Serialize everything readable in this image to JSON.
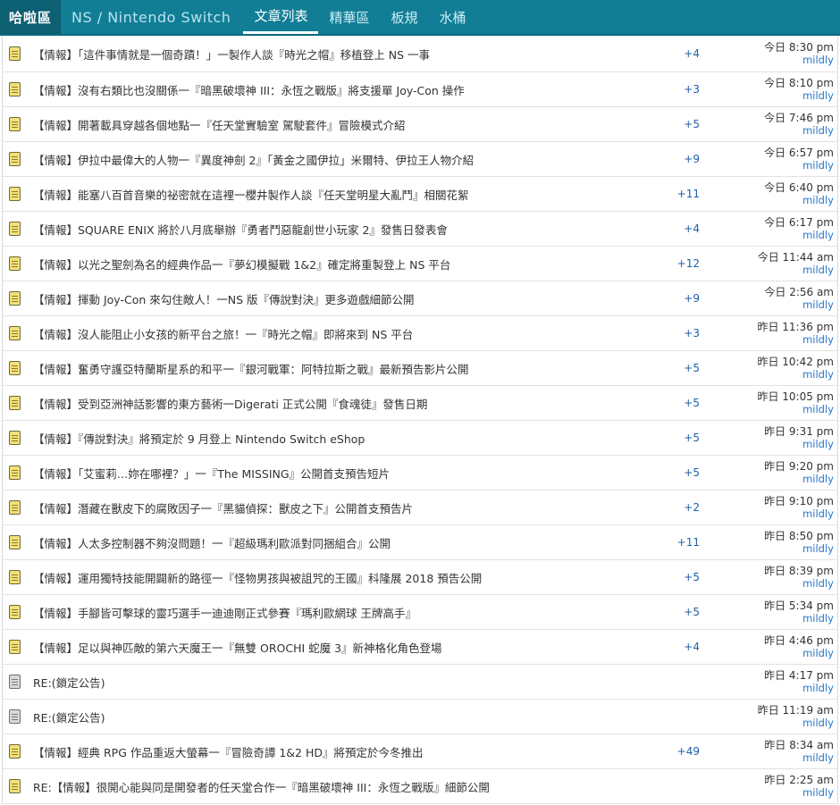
{
  "nav": {
    "brand": "哈啦區",
    "board": "NS / Nintendo Switch",
    "tabs": [
      {
        "label": "文章列表",
        "active": true
      },
      {
        "label": "精華區",
        "active": false
      },
      {
        "label": "板規",
        "active": false
      },
      {
        "label": "水桶",
        "active": false
      }
    ]
  },
  "topics": [
    {
      "icon": "doc-yellow-icon",
      "title": "【情報】「這件事情就是一個奇蹟！」一製作人談『時光之帽』移植登上 NS 一事",
      "count": "+4",
      "time": "今日 8:30 pm",
      "user": "mildly"
    },
    {
      "icon": "doc-yellow-icon",
      "title": "【情報】沒有右類比也沒關係一『暗黑破壞神 III：永恆之戰版』將支援單 Joy-Con 操作",
      "count": "+3",
      "time": "今日 8:10 pm",
      "user": "mildly"
    },
    {
      "icon": "doc-yellow-icon",
      "title": "【情報】開著載具穿越各個地點一『任天堂實驗室 駕駛套件』冒險模式介紹",
      "count": "+5",
      "time": "今日 7:46 pm",
      "user": "mildly"
    },
    {
      "icon": "doc-yellow-icon",
      "title": "【情報】伊拉中最偉大的人物一『異度神劍 2』「黃金之國伊拉」米爾特、伊拉王人物介紹",
      "count": "+9",
      "time": "今日 6:57 pm",
      "user": "mildly"
    },
    {
      "icon": "doc-yellow-icon",
      "title": "【情報】能塞八百首音樂的祕密就在這裡一櫻井製作人談『任天堂明星大亂鬥』相關花絮",
      "count": "+11",
      "time": "今日 6:40 pm",
      "user": "mildly"
    },
    {
      "icon": "doc-yellow-icon",
      "title": "【情報】SQUARE ENIX 將於八月底舉辦『勇者鬥惡龍創世小玩家 2』發售日發表會",
      "count": "+4",
      "time": "今日 6:17 pm",
      "user": "mildly"
    },
    {
      "icon": "doc-yellow-icon",
      "title": "【情報】以光之聖劍為名的經典作品一『夢幻模擬戰 1&2』確定將重製登上 NS 平台",
      "count": "+12",
      "time": "今日 11:44 am",
      "user": "mildly"
    },
    {
      "icon": "doc-yellow-icon",
      "title": "【情報】揮動 Joy-Con 來勾住敵人！一NS 版『傳說對決』更多遊戲細節公開",
      "count": "+9",
      "time": "今日 2:56 am",
      "user": "mildly"
    },
    {
      "icon": "doc-yellow-icon",
      "title": "【情報】沒人能阻止小女孩的新平台之旅！一『時光之帽』即將來到 NS 平台",
      "count": "+3",
      "time": "昨日 11:36 pm",
      "user": "mildly"
    },
    {
      "icon": "doc-yellow-icon",
      "title": "【情報】奮勇守護亞特蘭斯星系的和平一『銀河戰軍：阿特拉斯之戰』最新預告影片公開",
      "count": "+5",
      "time": "昨日 10:42 pm",
      "user": "mildly"
    },
    {
      "icon": "doc-yellow-icon",
      "title": "【情報】受到亞洲神話影響的東方藝術一Digerati 正式公開『食魂徒』發售日期",
      "count": "+5",
      "time": "昨日 10:05 pm",
      "user": "mildly"
    },
    {
      "icon": "doc-yellow-icon",
      "title": "【情報】『傳說對決』將預定於 9 月登上 Nintendo Switch eShop",
      "count": "+5",
      "time": "昨日 9:31 pm",
      "user": "mildly"
    },
    {
      "icon": "doc-yellow-icon",
      "title": "【情報】「艾蜜莉…妳在哪裡？」一『The MISSING』公開首支預告短片",
      "count": "+5",
      "time": "昨日 9:20 pm",
      "user": "mildly"
    },
    {
      "icon": "doc-yellow-icon",
      "title": "【情報】潛藏在獸皮下的腐敗因子一『黑貓偵探：獸皮之下』公開首支預告片",
      "count": "+2",
      "time": "昨日 9:10 pm",
      "user": "mildly"
    },
    {
      "icon": "doc-yellow-icon",
      "title": "【情報】人太多控制器不夠沒問題！一『超級瑪利歐派對同捆組合』公開",
      "count": "+11",
      "time": "昨日 8:50 pm",
      "user": "mildly"
    },
    {
      "icon": "doc-yellow-icon",
      "title": "【情報】運用獨特技能開闢新的路徑一『怪物男孩與被詛咒的王國』科隆展 2018 預告公開",
      "count": "+5",
      "time": "昨日 8:39 pm",
      "user": "mildly"
    },
    {
      "icon": "doc-yellow-icon",
      "title": "【情報】手腳皆可擊球的靈巧選手一迪迪剛正式參賽『瑪利歐網球 王牌高手』",
      "count": "+5",
      "time": "昨日 5:34 pm",
      "user": "mildly"
    },
    {
      "icon": "doc-yellow-icon",
      "title": "【情報】足以與神匹敵的第六天魔王一『無雙 OROCHI 蛇魔 3』新神格化角色登場",
      "count": "+4",
      "time": "昨日 4:46 pm",
      "user": "mildly"
    },
    {
      "icon": "doc-gray-icon",
      "title": "RE:(鎖定公告)",
      "count": "",
      "time": "昨日 4:17 pm",
      "user": "mildly"
    },
    {
      "icon": "doc-gray-icon",
      "title": "RE:(鎖定公告)",
      "count": "",
      "time": "昨日 11:19 am",
      "user": "mildly"
    },
    {
      "icon": "doc-yellow-icon",
      "title": "【情報】經典 RPG 作品重返大螢幕一『冒險奇譚 1&2 HD』將預定於今冬推出",
      "count": "+49",
      "time": "昨日 8:34 am",
      "user": "mildly"
    },
    {
      "icon": "doc-yellow-icon",
      "title": "RE:【情報】很開心能與同是開發者的任天堂合作一『暗黑破壞神 III：永恆之戰版』細節公開",
      "count": "",
      "time": "昨日 2:25 am",
      "user": "mildly"
    }
  ]
}
